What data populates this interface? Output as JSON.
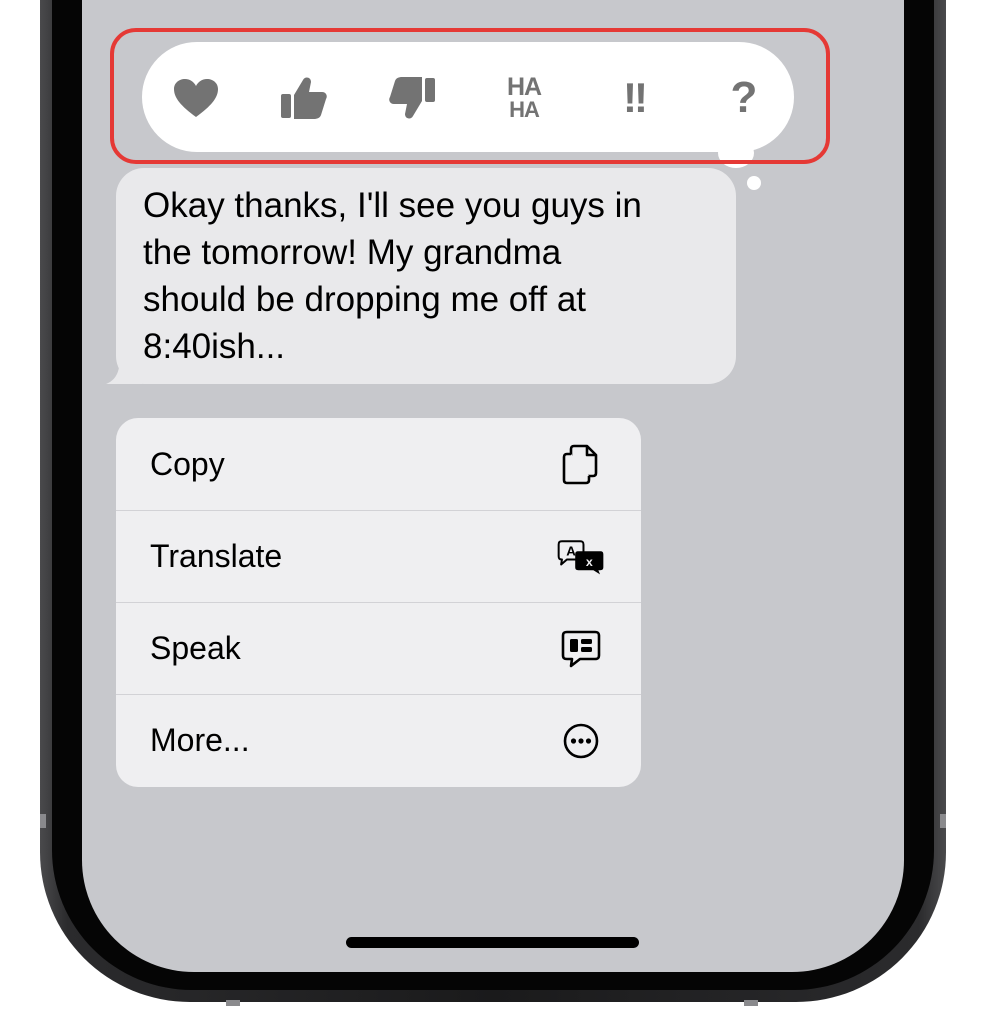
{
  "tapbacks": [
    {
      "name": "heart",
      "icon": "heart-icon"
    },
    {
      "name": "thumbs-up",
      "icon": "thumbs-up-icon"
    },
    {
      "name": "thumbs-down",
      "icon": "thumbs-down-icon"
    },
    {
      "name": "haha",
      "icon": "haha-icon",
      "line1": "HA",
      "line2": "HA"
    },
    {
      "name": "exclamation",
      "icon": "double-exclamation-icon",
      "label": "!!"
    },
    {
      "name": "question",
      "icon": "question-mark-icon",
      "label": "?"
    }
  ],
  "message": {
    "lines": [
      "Okay thanks, I'll see you guys in",
      "the tomorrow! My grandma",
      "should be dropping me off at",
      "8:40ish..."
    ]
  },
  "context_menu": {
    "items": [
      {
        "label": "Copy",
        "icon": "copy-icon"
      },
      {
        "label": "Translate",
        "icon": "translate-icon"
      },
      {
        "label": "Speak",
        "icon": "speak-icon"
      },
      {
        "label": "More...",
        "icon": "more-icon"
      }
    ]
  },
  "colors": {
    "screen_bg": "#c7c8cc",
    "tapback_icon": "#737373",
    "bubble_bg": "#e9e9eb",
    "menu_bg": "#efeff1",
    "highlight": "#e53935"
  }
}
